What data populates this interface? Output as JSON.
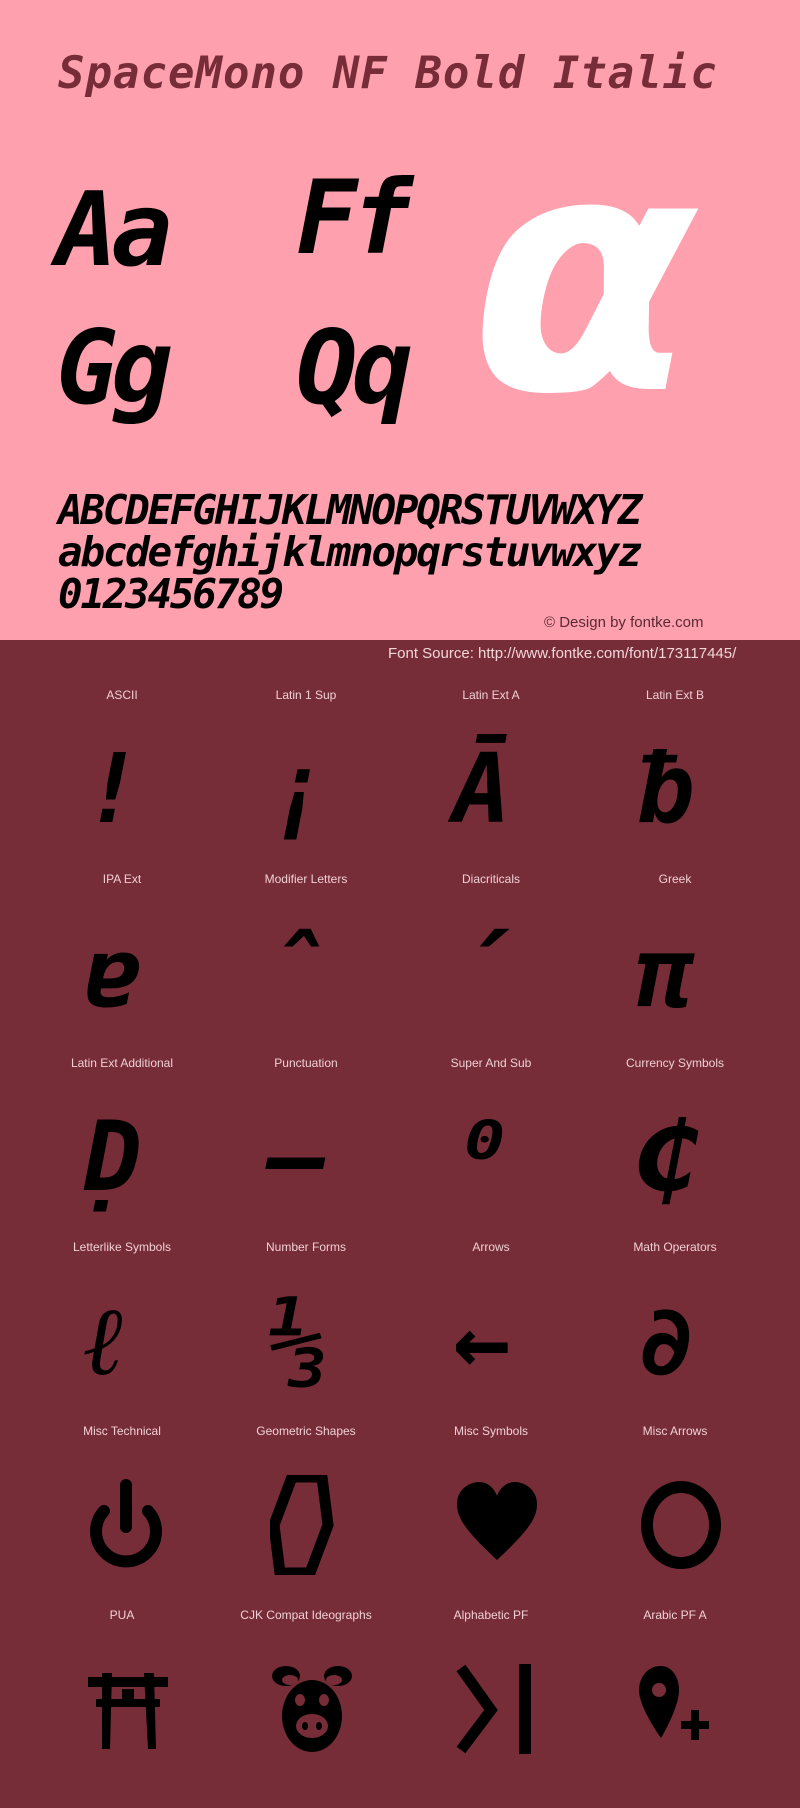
{
  "header": {
    "title": "SpaceMono NF Bold Italic",
    "samples": [
      "Aa",
      "Ff",
      "Gg",
      "Qq"
    ],
    "hero_glyph": "α",
    "alphabet_upper": "ABCDEFGHIJKLMNOPQRSTUVWXYZ",
    "alphabet_lower": "abcdefghijklmnopqrstuvwxyz",
    "digits": "0123456789",
    "credit": "© Design by fontke.com"
  },
  "source": "Font Source: http://www.fontke.com/font/173117445/",
  "colors": {
    "top_background": "#FFA0AE",
    "bottom_background": "#772D37",
    "title_color": "#772D37",
    "hero_color": "#FFFFFF",
    "glyph_color": "#000000"
  },
  "blocks": [
    {
      "label": "ASCII",
      "glyph": "!"
    },
    {
      "label": "Latin 1 Sup",
      "glyph": "¡"
    },
    {
      "label": "Latin Ext A",
      "glyph": "Ā"
    },
    {
      "label": "Latin Ext B",
      "glyph": "ƀ"
    },
    {
      "label": "IPA Ext",
      "glyph": "ɐ"
    },
    {
      "label": "Modifier Letters",
      "glyph": "ˆ"
    },
    {
      "label": "Diacriticals",
      "glyph": "´"
    },
    {
      "label": "Greek",
      "glyph": "π"
    },
    {
      "label": "Latin Ext Additional",
      "glyph": "Ḍ"
    },
    {
      "label": "Punctuation",
      "glyph": "–"
    },
    {
      "label": "Super And Sub",
      "glyph": "⁰"
    },
    {
      "label": "Currency Symbols",
      "glyph": "₵"
    },
    {
      "label": "Letterlike Symbols",
      "glyph": "ℓ"
    },
    {
      "label": "Number Forms",
      "glyph": "⅓"
    },
    {
      "label": "Arrows",
      "glyph": "←"
    },
    {
      "label": "Math Operators",
      "glyph": "∂"
    },
    {
      "label": "Misc Technical",
      "icon": "power-icon"
    },
    {
      "label": "Geometric Shapes",
      "icon": "hexagon-outline-icon"
    },
    {
      "label": "Misc Symbols",
      "icon": "heart-icon"
    },
    {
      "label": "Misc Arrows",
      "icon": "ring-icon"
    },
    {
      "label": "PUA",
      "icon": "torii-gate-icon"
    },
    {
      "label": "CJK Compat Ideographs",
      "icon": "pig-face-icon"
    },
    {
      "label": "Alphabetic PF",
      "icon": "chevron-bar-icon"
    },
    {
      "label": "Arabic PF A",
      "icon": "map-pin-plus-icon"
    }
  ]
}
